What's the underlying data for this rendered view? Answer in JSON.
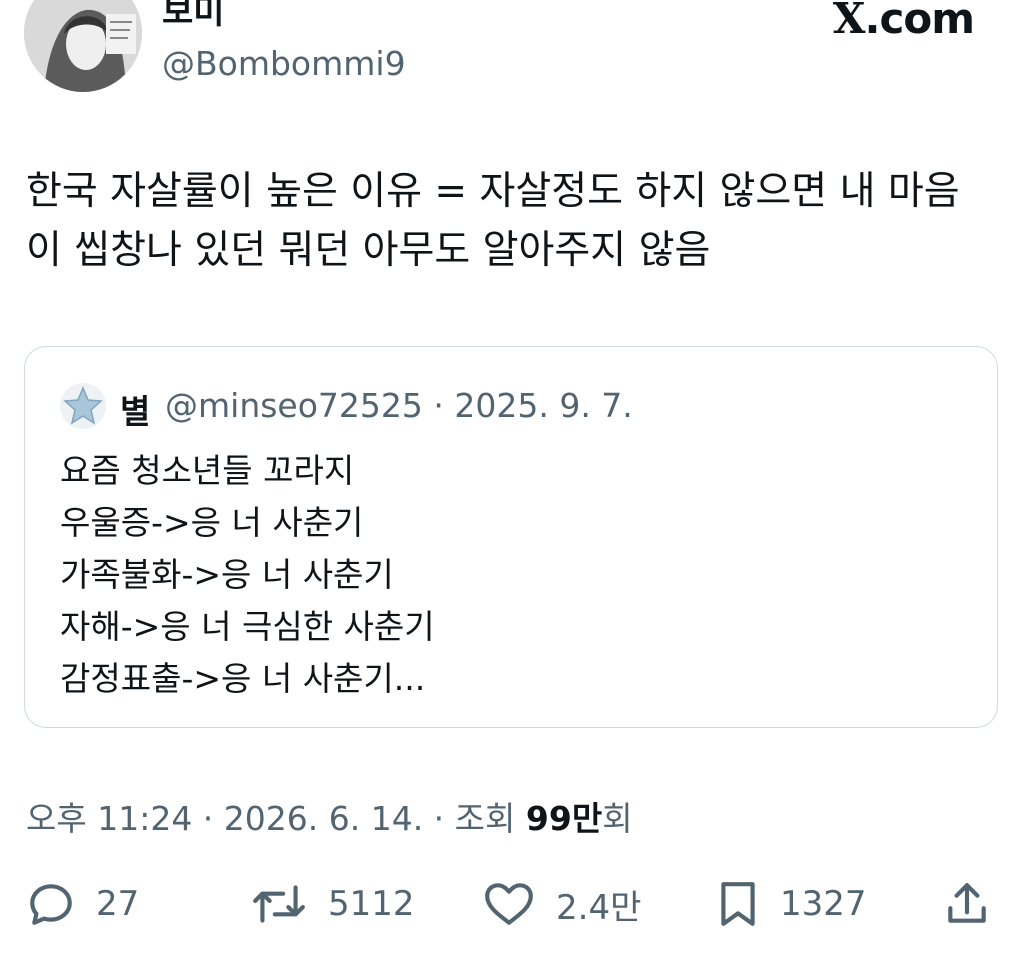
{
  "author": {
    "display_name": "보미",
    "handle": "@Bombommi9"
  },
  "brand": {
    "x_glyph": "X",
    "suffix": ".com"
  },
  "tweet": {
    "lines": [
      "한국 자살률이 높은 이유 = 자살정도 하지 않으면 내 마음",
      "이 씹창나 있던 뭐던 아무도 알아주지 않음"
    ]
  },
  "quote": {
    "display_name": "별",
    "meta": "@minseo72525 · 2025. 9. 7.",
    "lines": [
      "요즘 청소년들 꼬라지",
      "우울증->응 너 사춘기",
      "가족불화->응 너 사춘기",
      "자해->응 너 극심한 사춘기",
      "감정표출->응 너 사춘기..."
    ]
  },
  "timestamp": {
    "text": "오후 11:24 · 2026. 6. 14. · 조회 ",
    "views_number": "99",
    "views_unit": "만",
    "views_suffix": "회"
  },
  "actions": {
    "replies": "27",
    "reposts": "5112",
    "likes": "2.4만",
    "bookmarks": "1327"
  },
  "icons": {
    "reply": "reply-icon",
    "repost": "repost-icon",
    "like": "heart-icon",
    "bookmark": "bookmark-icon",
    "share": "share-icon"
  }
}
